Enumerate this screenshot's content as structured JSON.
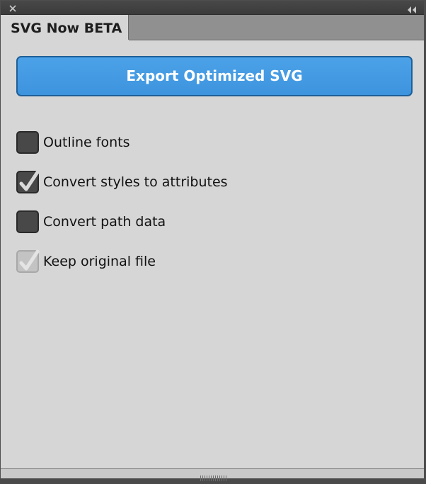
{
  "window": {
    "close_icon": "close-icon",
    "collapse_icon": "double-chevron-left-icon"
  },
  "tabs": [
    {
      "label": "SVG Now BETA",
      "active": true
    }
  ],
  "export_button": {
    "label": "Export Optimized SVG",
    "color": "#4a9fe6"
  },
  "options": [
    {
      "label": "Outline fonts",
      "checked": false,
      "enabled": true
    },
    {
      "label": "Convert styles to attributes",
      "checked": true,
      "enabled": true
    },
    {
      "label": "Convert path data",
      "checked": false,
      "enabled": true
    },
    {
      "label": "Keep original file",
      "checked": true,
      "enabled": false
    }
  ],
  "footer": {
    "grip_icon": "resize-grip-icon"
  }
}
